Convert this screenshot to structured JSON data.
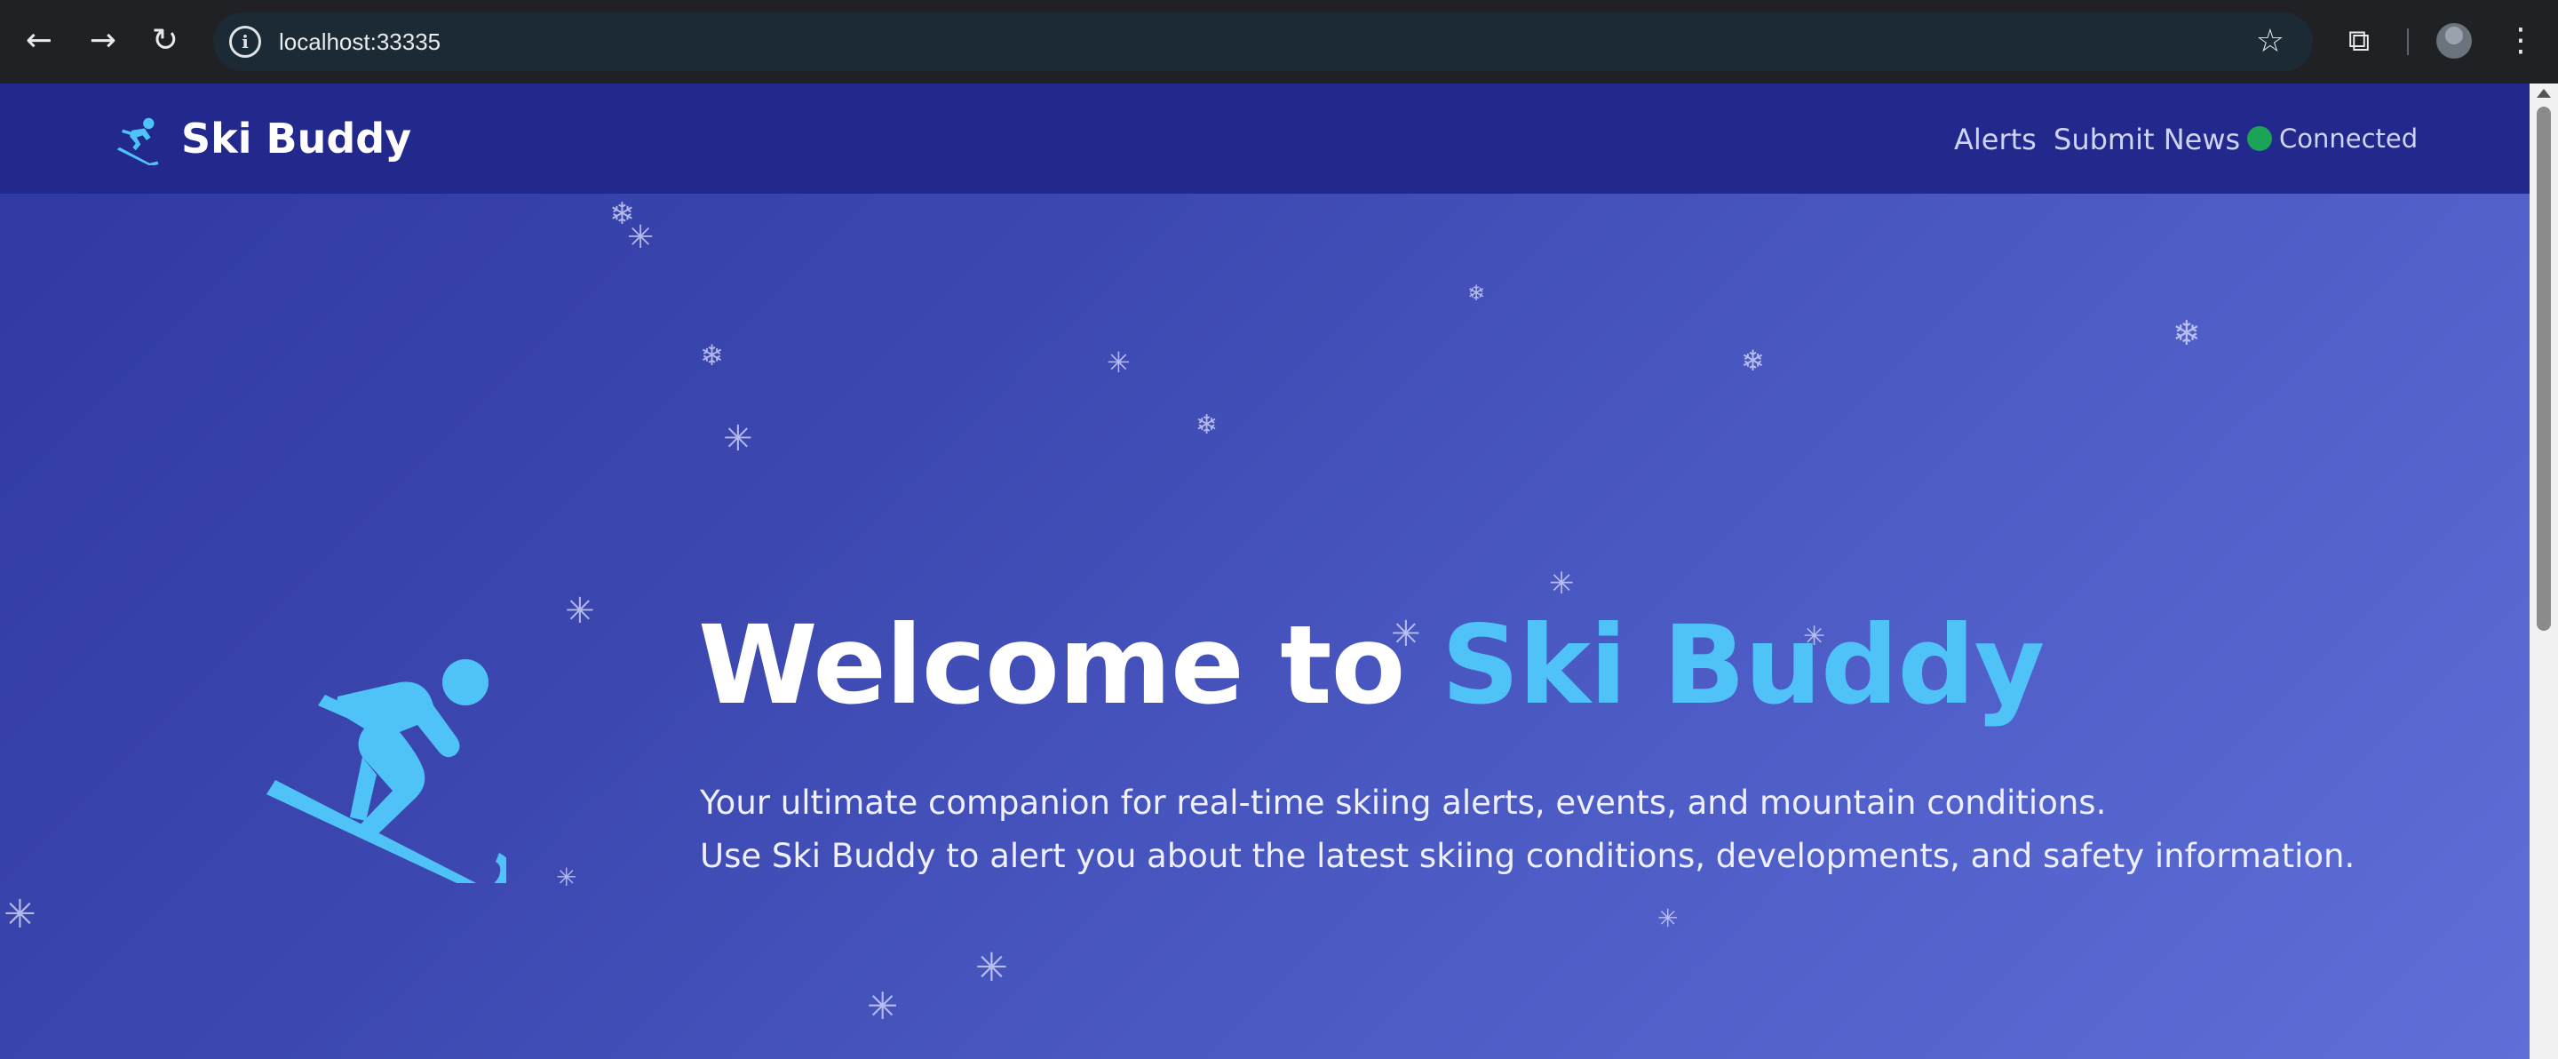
{
  "browser": {
    "back_icon": "arrow-left-icon",
    "forward_icon": "arrow-right-icon",
    "reload_icon": "reload-icon",
    "url": "localhost:33335",
    "site_info_icon": "info-icon",
    "bookmark_icon": "star-icon",
    "extensions_icon": "puzzle-icon",
    "menu_icon": "kebab-icon"
  },
  "navbar": {
    "brand": "Ski Buddy",
    "brand_icon": "skier-icon",
    "links": [
      "Alerts",
      "Submit News"
    ],
    "status": {
      "label": "Connected",
      "color": "#1da357"
    }
  },
  "hero": {
    "title_prefix": "Welcome to ",
    "title_accent": "Ski Buddy",
    "line1": "Your ultimate companion for real-time skiing alerts, events, and mountain conditions.",
    "line2": "Use Ski Buddy to alert you about the latest skiing conditions, developments, and safety information.",
    "icon": "skier-icon"
  },
  "colors": {
    "navbar_bg": "#22288c",
    "hero_gradient_start": "#2f38a0",
    "hero_gradient_end": "#5f6fd8",
    "accent": "#4fc3f7",
    "chrome_bg": "#202124"
  },
  "decor": {
    "snowflake_icon": "snowflake-icon"
  }
}
